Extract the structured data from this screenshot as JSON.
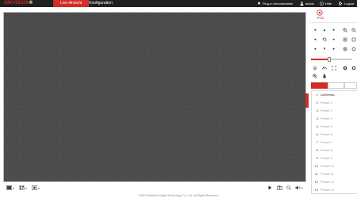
{
  "header": {
    "logo_red": "HIKVISION",
    "logo_suffix": "®",
    "tabs": [
      {
        "label": "Live-Ansicht",
        "active": true
      },
      {
        "label": "Konfiguration",
        "active": false
      }
    ],
    "links": {
      "plugin": "Plug-in herunterladen",
      "user": "admin",
      "help": "Hilfe",
      "logout": "Logout"
    }
  },
  "ptz": {
    "label": "PTZ",
    "speed_fraction": 0.45
  },
  "presets": {
    "items": [
      {
        "num": "1",
        "name": "Lichtemst..."
      },
      {
        "num": "2",
        "name": "Preset 2"
      },
      {
        "num": "3",
        "name": "Preset 3"
      },
      {
        "num": "4",
        "name": "Preset 4"
      },
      {
        "num": "5",
        "name": "Preset 5"
      },
      {
        "num": "6",
        "name": "Preset 6"
      },
      {
        "num": "7",
        "name": "Preset 7"
      },
      {
        "num": "8",
        "name": "Preset 8"
      },
      {
        "num": "9",
        "name": "Preset 9"
      },
      {
        "num": "10",
        "name": "Preset 10"
      },
      {
        "num": "11",
        "name": "Preset 11"
      },
      {
        "num": "12",
        "name": "Preset 12"
      },
      {
        "num": "13",
        "name": "Preset 13"
      }
    ]
  },
  "footer": {
    "copyright": "©2019 Hikvision Digital Technology Co., Ltd. All Rights Reserved."
  },
  "colors": {
    "accent": "#d12c26",
    "topbar": "#202020",
    "video_bg": "#4d4d4d"
  }
}
